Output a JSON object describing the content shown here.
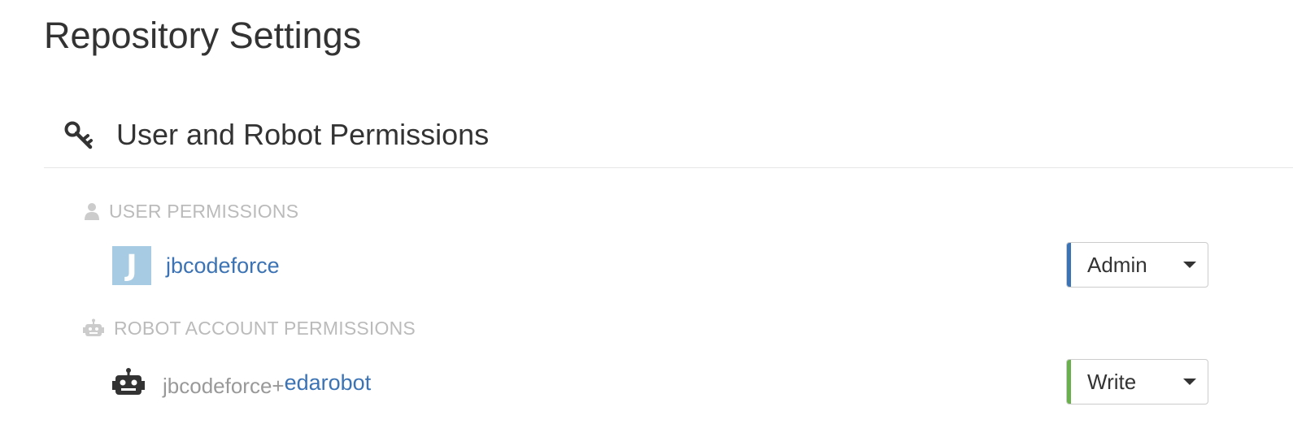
{
  "page": {
    "title": "Repository Settings"
  },
  "section": {
    "icon": "key-icon",
    "title": "User and Robot Permissions"
  },
  "user_permissions": {
    "icon": "user-icon",
    "label": "USER PERMISSIONS",
    "entries": [
      {
        "avatar_letter": "J",
        "avatar_color": "#a7cbe3",
        "name": "jbcodeforce",
        "role": "Admin",
        "role_color": "#3b73b4"
      }
    ]
  },
  "robot_permissions": {
    "icon": "robot-icon",
    "label": "ROBOT ACCOUNT PERMISSIONS",
    "entries": [
      {
        "avatar_icon": "robot-icon",
        "prefix": "jbcodeforce+",
        "shortname": "edarobot",
        "role": "Write",
        "role_color": "#6ab04c"
      }
    ]
  },
  "colors": {
    "link": "#3b73b4",
    "muted_label": "#bbbbbb",
    "robot_prefix": "#999999",
    "admin_accent": "#3b73b4",
    "write_accent": "#6ab04c"
  }
}
